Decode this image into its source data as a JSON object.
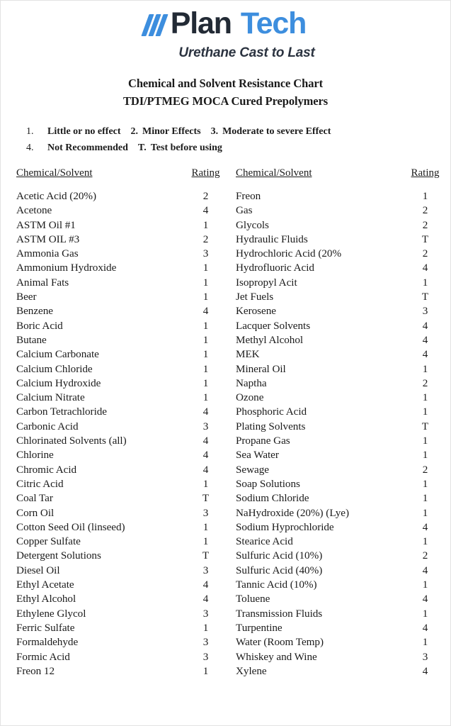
{
  "logo": {
    "mark": "three-slashes",
    "word_one": "Plan",
    "word_two": "Tech",
    "tagline": "Urethane Cast to Last",
    "color_blue": "#3d8ede",
    "color_dark": "#222a35"
  },
  "titles": {
    "line1": "Chemical and Solvent Resistance Chart",
    "line2": "TDI/PTMEG MOCA Cured Prepolymers"
  },
  "legend": {
    "row1": [
      {
        "key": "1.",
        "label": "Little or no effect"
      },
      {
        "key": "2.",
        "label": "Minor Effects"
      },
      {
        "key": "3.",
        "label": "Moderate to severe Effect"
      }
    ],
    "row2": [
      {
        "key": "4.",
        "label": "Not Recommended"
      },
      {
        "key": "T.",
        "label": "Test before using"
      }
    ]
  },
  "table": {
    "headers": {
      "chemical": "Chemical/Solvent",
      "rating": "Rating"
    },
    "left": [
      {
        "chemical": "Acetic Acid (20%)",
        "rating": "2"
      },
      {
        "chemical": "Acetone",
        "rating": "4"
      },
      {
        "chemical": "ASTM Oil  #1",
        "rating": "1"
      },
      {
        "chemical": "ASTM OIL #3",
        "rating": "2"
      },
      {
        "chemical": "Ammonia Gas",
        "rating": "3"
      },
      {
        "chemical": "Ammonium Hydroxide",
        "rating": "1"
      },
      {
        "chemical": "Animal Fats",
        "rating": "1"
      },
      {
        "chemical": "Beer",
        "rating": "1"
      },
      {
        "chemical": "Benzene",
        "rating": "4"
      },
      {
        "chemical": "Boric Acid",
        "rating": "1"
      },
      {
        "chemical": "Butane",
        "rating": "1"
      },
      {
        "chemical": "Calcium Carbonate",
        "rating": "1"
      },
      {
        "chemical": "Calcium Chloride",
        "rating": "1"
      },
      {
        "chemical": "Calcium Hydroxide",
        "rating": "1"
      },
      {
        "chemical": "Calcium Nitrate",
        "rating": "1"
      },
      {
        "chemical": "Carbon Tetrachloride",
        "rating": "4"
      },
      {
        "chemical": "Carbonic Acid",
        "rating": "3"
      },
      {
        "chemical": "Chlorinated Solvents (all)",
        "rating": "4"
      },
      {
        "chemical": "Chlorine",
        "rating": "4"
      },
      {
        "chemical": "Chromic Acid",
        "rating": "4"
      },
      {
        "chemical": "Citric Acid",
        "rating": "1"
      },
      {
        "chemical": "Coal Tar",
        "rating": "T"
      },
      {
        "chemical": "Corn Oil",
        "rating": "3"
      },
      {
        "chemical": "Cotton Seed Oil (linseed)",
        "rating": "1"
      },
      {
        "chemical": "Copper Sulfate",
        "rating": "1"
      },
      {
        "chemical": "Detergent Solutions",
        "rating": "T"
      },
      {
        "chemical": "Diesel Oil",
        "rating": "3"
      },
      {
        "chemical": "Ethyl Acetate",
        "rating": "4"
      },
      {
        "chemical": "Ethyl Alcohol",
        "rating": "4"
      },
      {
        "chemical": "Ethylene Glycol",
        "rating": "3"
      },
      {
        "chemical": "Ferric Sulfate",
        "rating": "1"
      },
      {
        "chemical": "Formaldehyde",
        "rating": "3"
      },
      {
        "chemical": "Formic Acid",
        "rating": "3"
      },
      {
        "chemical": "Freon 12",
        "rating": "1"
      }
    ],
    "right": [
      {
        "chemical": "Freon",
        "rating": "1"
      },
      {
        "chemical": "Gas",
        "rating": "2"
      },
      {
        "chemical": "Glycols",
        "rating": "2"
      },
      {
        "chemical": "Hydraulic Fluids",
        "rating": "T"
      },
      {
        "chemical": "Hydrochloric Acid (20%",
        "rating": "2"
      },
      {
        "chemical": "Hydrofluoric Acid",
        "rating": "4"
      },
      {
        "chemical": "Isopropyl Acit",
        "rating": "1"
      },
      {
        "chemical": "Jet Fuels",
        "rating": "T"
      },
      {
        "chemical": "Kerosene",
        "rating": "3"
      },
      {
        "chemical": "Lacquer Solvents",
        "rating": "4"
      },
      {
        "chemical": "Methyl Alcohol",
        "rating": "4"
      },
      {
        "chemical": "MEK",
        "rating": "4"
      },
      {
        "chemical": "Mineral Oil",
        "rating": "1"
      },
      {
        "chemical": "Naptha",
        "rating": "2"
      },
      {
        "chemical": "Ozone",
        "rating": "1"
      },
      {
        "chemical": "Phosphoric Acid",
        "rating": "1"
      },
      {
        "chemical": "Plating Solvents",
        "rating": "T"
      },
      {
        "chemical": "Propane Gas",
        "rating": "1"
      },
      {
        "chemical": "Sea Water",
        "rating": "1"
      },
      {
        "chemical": "Sewage",
        "rating": "2"
      },
      {
        "chemical": "Soap Solutions",
        "rating": "1"
      },
      {
        "chemical": "Sodium Chloride",
        "rating": "1"
      },
      {
        "chemical": "NaHydroxide (20%) (Lye)",
        "rating": "1"
      },
      {
        "chemical": "Sodium Hyprochloride",
        "rating": "4"
      },
      {
        "chemical": "Stearice Acid",
        "rating": "1"
      },
      {
        "chemical": "Sulfuric Acid (10%)",
        "rating": "2"
      },
      {
        "chemical": "Sulfuric Acid (40%)",
        "rating": "4"
      },
      {
        "chemical": "Tannic Acid (10%)",
        "rating": "1"
      },
      {
        "chemical": "Toluene",
        "rating": "4"
      },
      {
        "chemical": "Transmission Fluids",
        "rating": "1"
      },
      {
        "chemical": "Turpentine",
        "rating": "4"
      },
      {
        "chemical": "Water (Room Temp)",
        "rating": "1"
      },
      {
        "chemical": "Whiskey and Wine",
        "rating": "3"
      },
      {
        "chemical": "Xylene",
        "rating": "4"
      }
    ]
  }
}
